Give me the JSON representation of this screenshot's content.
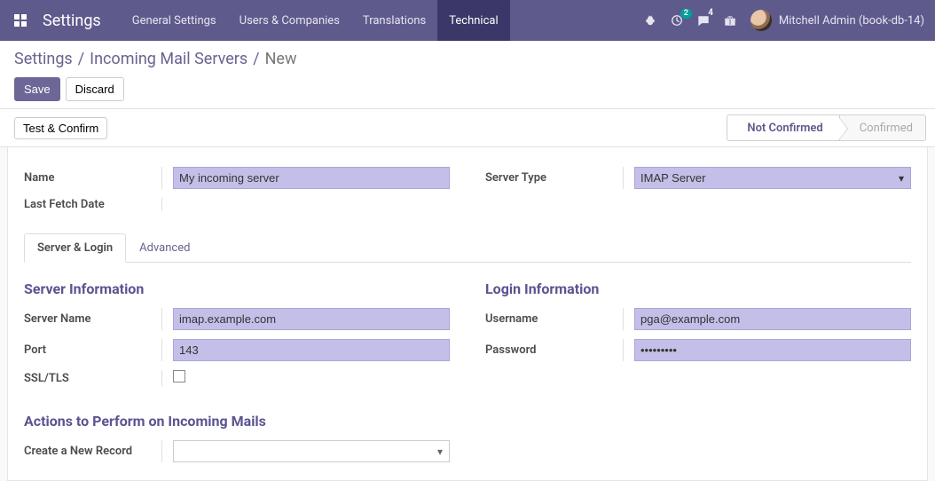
{
  "navbar": {
    "app_title": "Settings",
    "menu": [
      {
        "label": "General Settings",
        "active": false
      },
      {
        "label": "Users & Companies",
        "active": false
      },
      {
        "label": "Translations",
        "active": false
      },
      {
        "label": "Technical",
        "active": true
      }
    ],
    "badge_activities": "2",
    "badge_messages": "4",
    "user_name": "Mitchell Admin (book-db-14)"
  },
  "breadcrumb": {
    "root": "Settings",
    "parent": "Incoming Mail Servers",
    "current": "New"
  },
  "buttons": {
    "save": "Save",
    "discard": "Discard",
    "test_confirm": "Test & Confirm"
  },
  "status": {
    "not_confirmed": "Not Confirmed",
    "confirmed": "Confirmed"
  },
  "form": {
    "top": {
      "name_label": "Name",
      "name_value": "My incoming server",
      "last_fetch_label": "Last Fetch Date",
      "last_fetch_value": "",
      "server_type_label": "Server Type",
      "server_type_value": "IMAP Server"
    },
    "tabs": {
      "server_login": "Server & Login",
      "advanced": "Advanced"
    },
    "sections": {
      "server_info": "Server Information",
      "login_info": "Login Information",
      "actions": "Actions to Perform on Incoming Mails"
    },
    "server": {
      "server_name_label": "Server Name",
      "server_name_value": "imap.example.com",
      "port_label": "Port",
      "port_value": "143",
      "ssl_label": "SSL/TLS",
      "ssl_value": false
    },
    "login": {
      "username_label": "Username",
      "username_value": "pga@example.com",
      "password_label": "Password",
      "password_value": "•••••••••"
    },
    "actions": {
      "create_record_label": "Create a New Record",
      "create_record_value": ""
    }
  }
}
